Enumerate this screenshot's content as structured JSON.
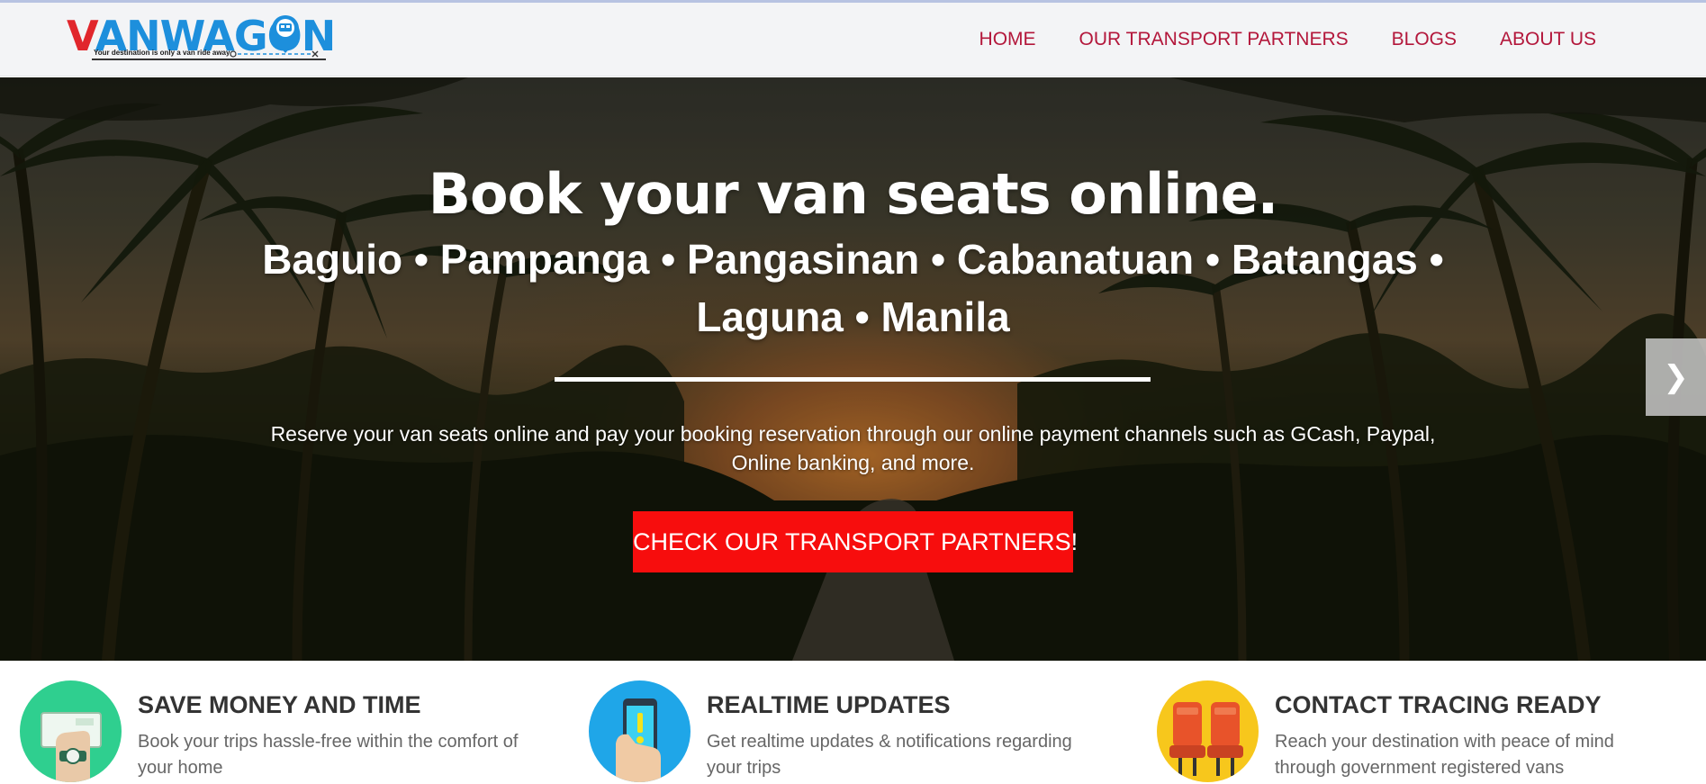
{
  "brand": {
    "logo_text_first": "V",
    "logo_text_rest": "ANWAGON",
    "tagline": "Your destination is only a van ride away"
  },
  "nav": {
    "items": [
      {
        "label": "HOME"
      },
      {
        "label": "OUR TRANSPORT PARTNERS"
      },
      {
        "label": "BLOGS"
      },
      {
        "label": "ABOUT US"
      }
    ]
  },
  "hero": {
    "title": "Book your van seats online.",
    "cities": "Baguio • Pampanga • Pangasinan • Cabanatuan • Batangas • Laguna • Manila",
    "description": "Reserve your van seats online and pay your booking reservation through our online payment channels such as GCash, Paypal, Online banking, and more.",
    "cta_label": "CHECK OUR TRANSPORT PARTNERS!",
    "next_label": "❯"
  },
  "features": [
    {
      "title": "SAVE MONEY AND TIME",
      "text": "Book your trips hassle-free within the comfort of your home",
      "icon": "hand-ticket-icon",
      "icon_bg": "#2fcf8f"
    },
    {
      "title": "REALTIME UPDATES",
      "text": "Get realtime updates & notifications regarding your trips",
      "icon": "phone-notification-icon",
      "icon_bg": "#1fa6e8"
    },
    {
      "title": "CONTACT TRACING READY",
      "text": "Reach your destination with peace of mind through government registered vans",
      "icon": "van-seats-icon",
      "icon_bg": "#f7c71c"
    }
  ],
  "colors": {
    "nav_link": "#b3173b",
    "cta_bg": "#f70d0d",
    "logo_red": "#e1262c",
    "logo_blue": "#1d8fdc"
  }
}
